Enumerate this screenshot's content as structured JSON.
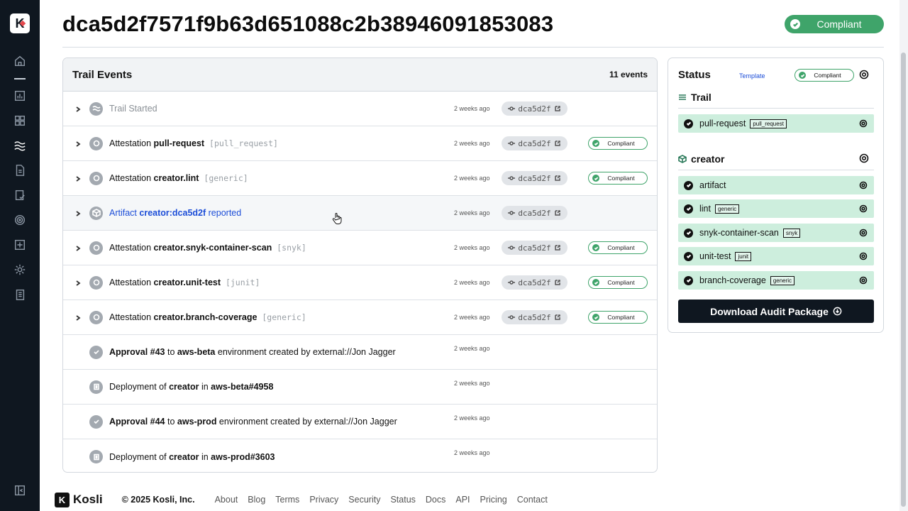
{
  "app": {
    "logo_letter": "K",
    "brand": "Kosli"
  },
  "sidebar": {
    "icons": [
      "home-icon",
      "dashboard-icon",
      "grid-icon",
      "trails-icon",
      "document-icon",
      "policy-icon",
      "target-icon",
      "add-icon",
      "settings-icon",
      "report-icon",
      "collapse-icon"
    ]
  },
  "header": {
    "title": "dca5d2f7571f9b63d651088c2b38946091853083",
    "badge": "Compliant"
  },
  "events": {
    "title": "Trail Events",
    "count": "11 events",
    "rows": [
      {
        "icon": "trail-icon",
        "prefix": "Trail Started",
        "bold": "",
        "mono": "",
        "suffix": "",
        "time": "2 weeks ago",
        "commit": "dca5d2f",
        "badge": "",
        "style": "muted"
      },
      {
        "icon": "attestation-icon",
        "prefix": "Attestation ",
        "bold": "pull-request",
        "mono": " [pull_request]",
        "suffix": "",
        "time": "2 weeks ago",
        "commit": "dca5d2f",
        "badge": "Compliant",
        "style": ""
      },
      {
        "icon": "attestation-icon",
        "prefix": "Attestation ",
        "bold": "creator.lint",
        "mono": " [generic]",
        "suffix": "",
        "time": "2 weeks ago",
        "commit": "dca5d2f",
        "badge": "Compliant",
        "style": ""
      },
      {
        "icon": "artifact-icon",
        "prefix": "Artifact ",
        "bold": "creator:dca5d2f",
        "mono": "",
        "suffix": " reported",
        "time": "2 weeks ago",
        "commit": "dca5d2f",
        "badge": "",
        "style": "link"
      },
      {
        "icon": "attestation-icon",
        "prefix": "Attestation ",
        "bold": "creator.snyk-container-scan",
        "mono": " [snyk]",
        "suffix": "",
        "time": "2 weeks ago",
        "commit": "dca5d2f",
        "badge": "Compliant",
        "style": ""
      },
      {
        "icon": "attestation-icon",
        "prefix": "Attestation ",
        "bold": "creator.unit-test",
        "mono": " [junit]",
        "suffix": "",
        "time": "2 weeks ago",
        "commit": "dca5d2f",
        "badge": "Compliant",
        "style": ""
      },
      {
        "icon": "attestation-icon",
        "prefix": "Attestation ",
        "bold": "creator.branch-coverage",
        "mono": " [generic]",
        "suffix": "",
        "time": "2 weeks ago",
        "commit": "dca5d2f",
        "badge": "Compliant",
        "style": ""
      }
    ],
    "approvals": [
      {
        "icon": "approval-icon",
        "b1": "Approval #43",
        "t1": " to ",
        "b2": "aws-beta",
        "t2": " environment created by external://Jon Jagger",
        "time": "2 weeks ago"
      },
      {
        "icon": "deployment-icon",
        "t0": "Deployment of ",
        "b1": "creator",
        "t1": " in ",
        "b2": "aws-beta#4958",
        "time": "2 weeks ago"
      },
      {
        "icon": "approval-icon",
        "b1": "Approval #44",
        "t1": " to ",
        "b2": "aws-prod",
        "t2": " environment created by external://Jon Jagger",
        "time": "2 weeks ago"
      },
      {
        "icon": "deployment-icon",
        "t0": "Deployment of ",
        "b1": "creator",
        "t1": " in ",
        "b2": "aws-prod#3603",
        "time": "2 weeks ago"
      }
    ]
  },
  "status": {
    "title": "Status",
    "template_link": "Template",
    "badge": "Compliant",
    "trail_section": "Trail",
    "trail_items": [
      {
        "label": "pull-request",
        "tag": "pull_request"
      }
    ],
    "creator_section": "creator",
    "creator_items": [
      {
        "label": "artifact",
        "tag": ""
      },
      {
        "label": "lint",
        "tag": "generic"
      },
      {
        "label": "snyk-container-scan",
        "tag": "snyk"
      },
      {
        "label": "unit-test",
        "tag": "junit"
      },
      {
        "label": "branch-coverage",
        "tag": "generic"
      }
    ],
    "download_button": "Download Audit Package"
  },
  "footer": {
    "copyright": "© 2025 Kosli, Inc.",
    "links": [
      "About",
      "Blog",
      "Terms",
      "Privacy",
      "Security",
      "Status",
      "Docs",
      "API",
      "Pricing",
      "Contact"
    ]
  },
  "colors": {
    "sidebar": "#0f1720",
    "compliant": "#3fa46a",
    "status_item_bg": "#cdeedd",
    "link": "#1d4ed8"
  }
}
